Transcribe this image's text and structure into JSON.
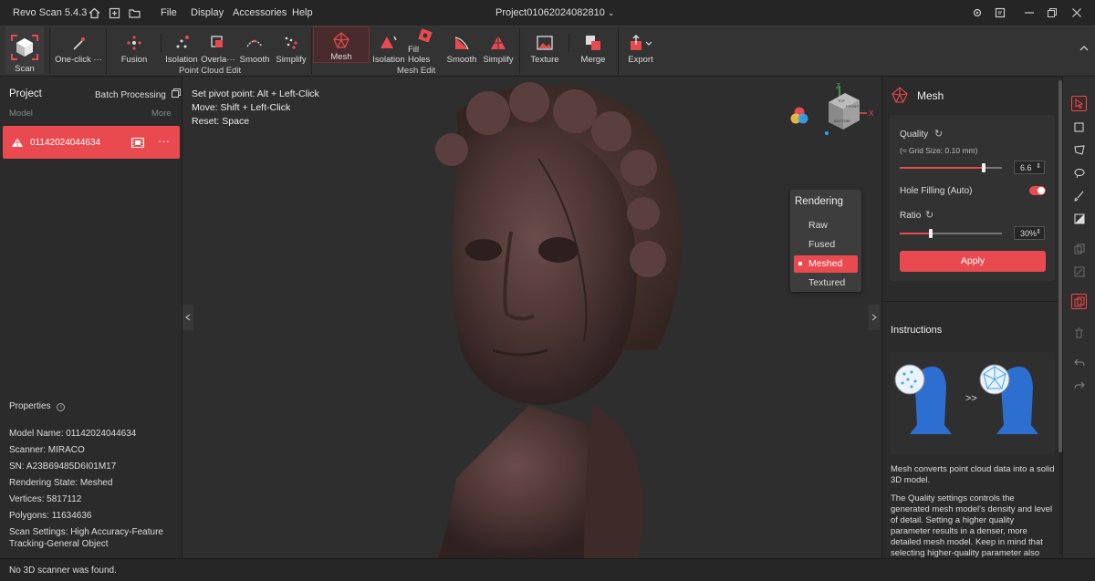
{
  "app": {
    "title": "Revo Scan 5.4.3",
    "project_title": "Project01062024082810"
  },
  "menu": [
    "File",
    "Display",
    "Accessories",
    "Help"
  ],
  "toolbar": {
    "scan": "Scan",
    "one_click": "One-click ···",
    "fusion": "Fusion",
    "pc_isolation": "Isolation",
    "pc_overlap": "Overla···",
    "pc_smooth": "Smooth",
    "pc_simplify": "Simplify",
    "point_cloud_edit": "Point Cloud Edit",
    "mesh": "Mesh",
    "m_isolation": "Isolation",
    "fill_holes": "Fill Holes",
    "m_smooth": "Smooth",
    "m_simplify": "Simplify",
    "mesh_edit": "Mesh Edit",
    "texture": "Texture",
    "merge": "Merge",
    "export": "Export"
  },
  "left": {
    "project": "Project",
    "batch": "Batch Processing",
    "model_col": "Model",
    "more_col": "More",
    "model_name": "01142024044634",
    "properties": "Properties",
    "props": [
      "Model Name:  01142024044634",
      "Scanner:  MIRACO",
      "SN:  A23B69485D6I01M17",
      "Rendering State:  Meshed",
      "Vertices:  5817112",
      "Polygons:  11634636",
      "Scan Settings:  High Accuracy-Feature",
      "Tracking-General Object"
    ]
  },
  "viewport": {
    "hints": [
      "Set pivot point:  Alt + Left-Click",
      "Move:  Shift + Left-Click",
      "Reset:  Space"
    ],
    "cube": {
      "top": "TOP",
      "front": "FRONT",
      "bottom": "BOTTOM",
      "z": "Z",
      "x": "X"
    },
    "rendering": {
      "title": "Rendering",
      "items": [
        "Raw",
        "Fused",
        "Meshed",
        "Textured"
      ],
      "active": "Meshed"
    }
  },
  "right": {
    "title": "Mesh",
    "quality_label": "Quality",
    "grid_size": "(≈ Grid Size: 0.10 mm)",
    "quality_value": "6.6",
    "quality_level": 0.82,
    "hole_filling": "Hole Filling (Auto)",
    "ratio_label": "Ratio",
    "ratio_value": "30%",
    "ratio_level": 0.3,
    "apply": "Apply",
    "instructions": "Instructions",
    "instr_1": "Mesh converts point cloud data into a solid 3D model.",
    "instr_2": "The Quality settings controls the generated mesh model's density and level of detail. Setting a higher quality parameter results in a denser, more detailed mesh model. Keep in mind that selecting higher-quality parameter also increases the processing",
    "arrows": ">>"
  },
  "status": "No 3D scanner was found.",
  "colors": {
    "accent": "#e84a4f",
    "bg": "#2e2e2e",
    "panel": "#2b2b2b"
  }
}
